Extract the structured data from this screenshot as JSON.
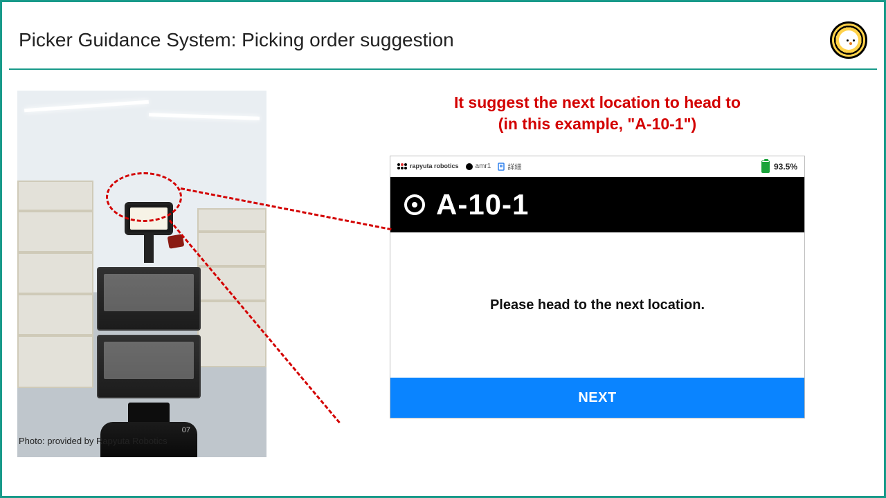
{
  "title": "Picker Guidance System: Picking order suggestion",
  "annotation": {
    "line1": "It suggest the next location to head to",
    "line2": "(in this example, \"A-10-1\")"
  },
  "ui": {
    "brand": "rapyuta robotics",
    "amr_badge": "amr1",
    "detail_badge": "詳細",
    "battery_pct": "93.5%",
    "location_code": "A-10-1",
    "instruction": "Please head to the next location.",
    "next_button": "NEXT"
  },
  "robot": {
    "unit_label": "07"
  },
  "credit": "Photo: provided by Rapyuta Robotics"
}
